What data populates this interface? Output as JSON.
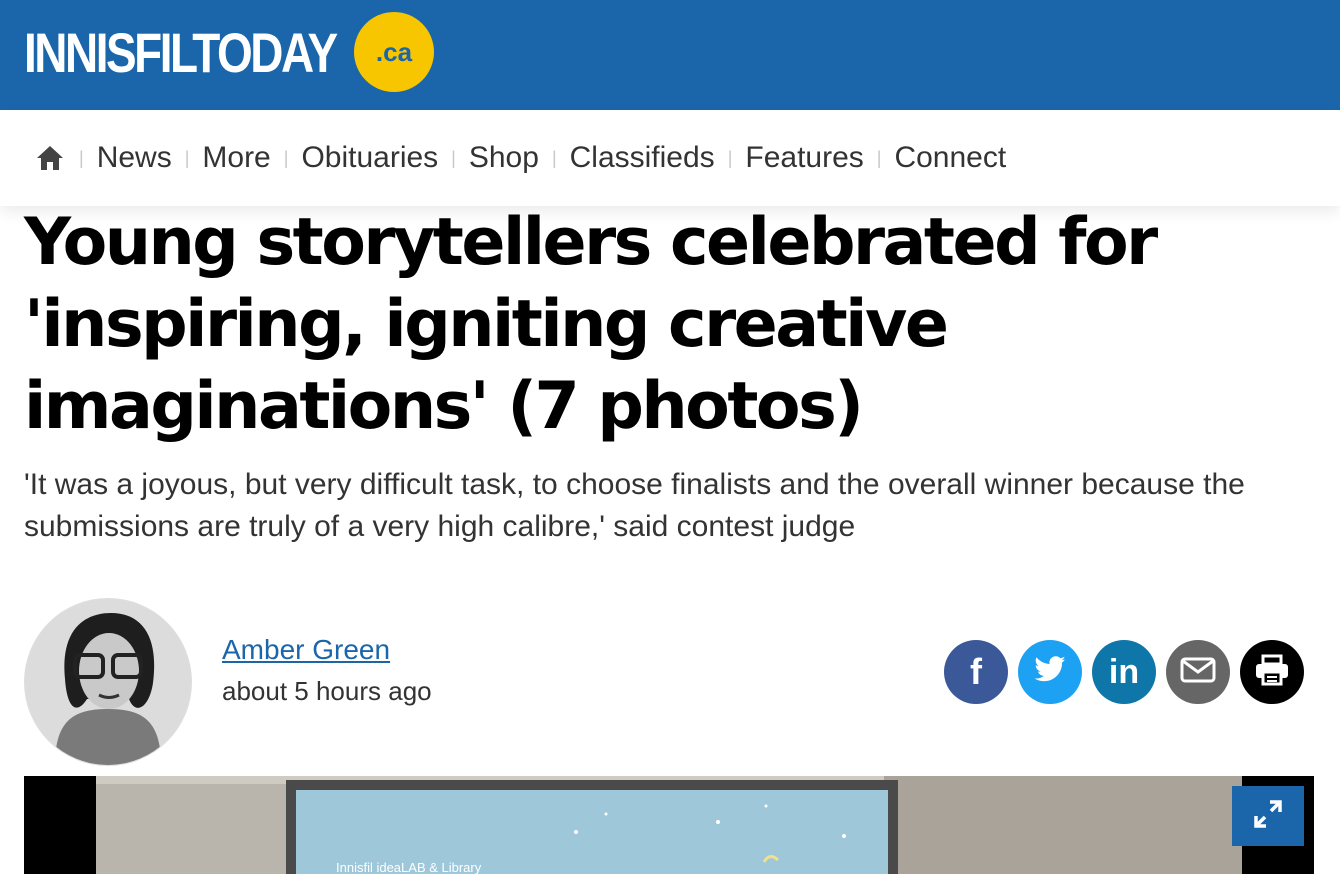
{
  "site": {
    "logo_text": "INNISFILTODAY",
    "logo_badge": ".ca",
    "brand_color": "#1b66ab",
    "badge_color": "#f7c600"
  },
  "nav": {
    "home_icon": "home-icon",
    "items": [
      "News",
      "More",
      "Obituaries",
      "Shop",
      "Classifieds",
      "Features",
      "Connect"
    ]
  },
  "article": {
    "headline_lines": [
      "Young storytellers celebrated for",
      "'inspiring, igniting creative",
      "imaginations' (7 photos)"
    ],
    "dek": "'It was a joyous, but very difficult task, to choose finalists and the overall winner because the submissions are truly of a very high calibre,' said contest judge",
    "author": "Amber Green",
    "time": "about 5 hours ago"
  },
  "share": [
    {
      "name": "facebook",
      "icon": "facebook-icon",
      "color": "#3b5998"
    },
    {
      "name": "twitter",
      "icon": "twitter-icon",
      "color": "#1da1f2"
    },
    {
      "name": "linkedin",
      "icon": "linkedin-icon",
      "color": "#0e76a8"
    },
    {
      "name": "email",
      "icon": "email-icon",
      "color": "#666666"
    },
    {
      "name": "print",
      "icon": "print-icon",
      "color": "#000000"
    }
  ],
  "photo": {
    "screen_text": "Innisfil ideaLAB & Library",
    "expand_icon": "expand-icon"
  }
}
